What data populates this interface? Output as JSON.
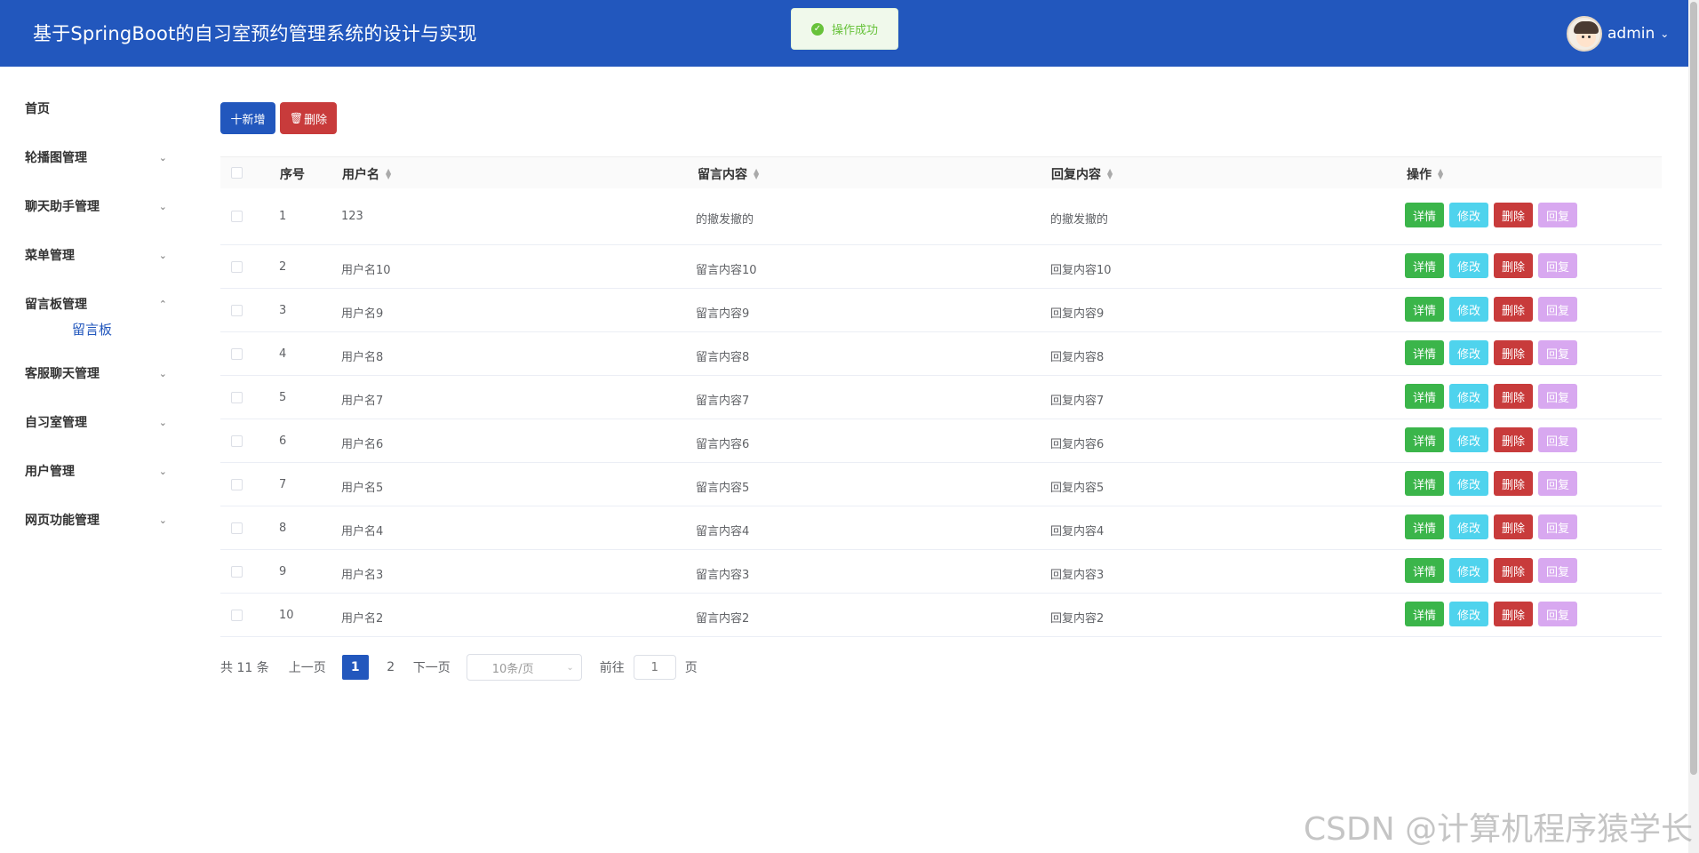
{
  "header": {
    "title": "基于SpringBoot的自习室预约管理系统的设计与实现",
    "username": "admin"
  },
  "toast": {
    "message": "操作成功"
  },
  "sidebar": {
    "items": [
      {
        "label": "首页"
      },
      {
        "label": "轮播图管理"
      },
      {
        "label": "聊天助手管理"
      },
      {
        "label": "菜单管理"
      },
      {
        "label": "留言板管理",
        "expanded": true,
        "children": [
          {
            "label": "留言板"
          }
        ]
      },
      {
        "label": "客服聊天管理"
      },
      {
        "label": "自习室管理"
      },
      {
        "label": "用户管理"
      },
      {
        "label": "网页功能管理"
      }
    ]
  },
  "toolbar": {
    "add_label": "十新增",
    "delete_label": "删除"
  },
  "table": {
    "columns": [
      "序号",
      "用户名",
      "留言内容",
      "回复内容",
      "操作"
    ],
    "row_actions": [
      "详情",
      "修改",
      "删除",
      "回复"
    ],
    "rows": [
      {
        "index": "1",
        "username": "123",
        "message": "的撤发撤的",
        "reply": "的撤发撤的"
      },
      {
        "index": "2",
        "username": "用户名10",
        "message": "留言内容10",
        "reply": "回复内容10"
      },
      {
        "index": "3",
        "username": "用户名9",
        "message": "留言内容9",
        "reply": "回复内容9"
      },
      {
        "index": "4",
        "username": "用户名8",
        "message": "留言内容8",
        "reply": "回复内容8"
      },
      {
        "index": "5",
        "username": "用户名7",
        "message": "留言内容7",
        "reply": "回复内容7"
      },
      {
        "index": "6",
        "username": "用户名6",
        "message": "留言内容6",
        "reply": "回复内容6"
      },
      {
        "index": "7",
        "username": "用户名5",
        "message": "留言内容5",
        "reply": "回复内容5"
      },
      {
        "index": "8",
        "username": "用户名4",
        "message": "留言内容4",
        "reply": "回复内容4"
      },
      {
        "index": "9",
        "username": "用户名3",
        "message": "留言内容3",
        "reply": "回复内容3"
      },
      {
        "index": "10",
        "username": "用户名2",
        "message": "留言内容2",
        "reply": "回复内容2"
      }
    ]
  },
  "pagination": {
    "total": "共 11 条",
    "prev": "上一页",
    "pages": [
      "1",
      "2"
    ],
    "current": "1",
    "next": "下一页",
    "page_size": "10条/页",
    "goto_label": "前往",
    "goto_value": "1",
    "page_unit": "页"
  },
  "watermark": "CSDN @计算机程序猿学长",
  "colors": {
    "header_bg": "#2257bd",
    "primary": "#2257bd",
    "danger": "#c83b3b",
    "success": "#3bb54a",
    "info": "#4fd3ed",
    "reply": "#d8a8f0"
  }
}
